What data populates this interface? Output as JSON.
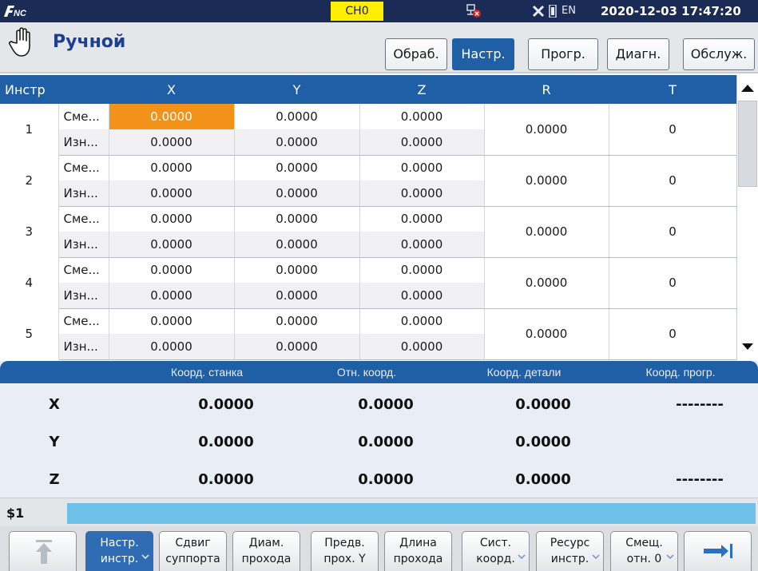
{
  "status_bar": {
    "logo_text": "FNC",
    "channel": "CH0",
    "language": "EN",
    "datetime": "2020-12-03 17:47:20",
    "icons": [
      "network-error-icon",
      "close-icon",
      "bar-icon"
    ]
  },
  "mode": {
    "title": "Ручной",
    "icon": "hand-icon"
  },
  "tabs": [
    {
      "label": "Обраб.",
      "active": false
    },
    {
      "label": "Настр.",
      "active": true
    },
    {
      "label": "Прогр.",
      "active": false
    },
    {
      "label": "Диагн.",
      "active": false
    },
    {
      "label": "Обслуж.",
      "active": false
    }
  ],
  "tool_table": {
    "headers": [
      "Инстр",
      "X",
      "Y",
      "Z",
      "R",
      "T"
    ],
    "selected_cell": {
      "tool": 1,
      "row": "offset",
      "column": "X"
    },
    "tools": [
      {
        "num": "1",
        "offset_label": "Сме...",
        "wear_label": "Изн...",
        "offset": [
          "0.0000",
          "0.0000",
          "0.0000"
        ],
        "wear": [
          "0.0000",
          "0.0000",
          "0.0000"
        ],
        "r": "0.0000",
        "t": "0"
      },
      {
        "num": "2",
        "offset_label": "Сме...",
        "wear_label": "Изн...",
        "offset": [
          "0.0000",
          "0.0000",
          "0.0000"
        ],
        "wear": [
          "0.0000",
          "0.0000",
          "0.0000"
        ],
        "r": "0.0000",
        "t": "0"
      },
      {
        "num": "3",
        "offset_label": "Сме...",
        "wear_label": "Изн...",
        "offset": [
          "0.0000",
          "0.0000",
          "0.0000"
        ],
        "wear": [
          "0.0000",
          "0.0000",
          "0.0000"
        ],
        "r": "0.0000",
        "t": "0"
      },
      {
        "num": "4",
        "offset_label": "Сме...",
        "wear_label": "Изн...",
        "offset": [
          "0.0000",
          "0.0000",
          "0.0000"
        ],
        "wear": [
          "0.0000",
          "0.0000",
          "0.0000"
        ],
        "r": "0.0000",
        "t": "0"
      },
      {
        "num": "5",
        "offset_label": "Сме...",
        "wear_label": "Изн...",
        "offset": [
          "0.0000",
          "0.0000",
          "0.0000"
        ],
        "wear": [
          "0.0000",
          "0.0000",
          "0.0000"
        ],
        "r": "0.0000",
        "t": "0"
      }
    ]
  },
  "coords": {
    "headers": [
      "Коорд. станка",
      "Отн. коорд.",
      "Коорд. детали",
      "Коорд. прогр."
    ],
    "rows": [
      {
        "axis": "X",
        "values": [
          "0.0000",
          "0.0000",
          "0.0000",
          "--------"
        ]
      },
      {
        "axis": "Y",
        "values": [
          "0.0000",
          "0.0000",
          "0.0000",
          ""
        ]
      },
      {
        "axis": "Z",
        "values": [
          "0.0000",
          "0.0000",
          "0.0000",
          "--------"
        ]
      }
    ]
  },
  "command": {
    "prompt": "$1",
    "value": ""
  },
  "softkeys": [
    {
      "icon": "return-to-top-icon"
    },
    {
      "line1": "Настр.",
      "line2": "инстр.",
      "chevron": true,
      "active": true
    },
    {
      "line1": "Сдвиг",
      "line2": "суппорта",
      "chevron": false,
      "active": false
    },
    {
      "line1": "Диам.",
      "line2": "прохода",
      "chevron": false,
      "active": false
    },
    {
      "line1": "Предв.",
      "line2": "прох. Y",
      "chevron": false,
      "active": false
    },
    {
      "line1": "Длина",
      "line2": "прохода",
      "chevron": false,
      "active": false
    },
    {
      "line1": "Сист.",
      "line2": "коорд.",
      "chevron": true,
      "active": false
    },
    {
      "line1": "Ресурс",
      "line2": "инстр.",
      "chevron": true,
      "active": false
    },
    {
      "line1": "Смещ.",
      "line2": "отн. 0",
      "chevron": true,
      "active": false
    },
    {
      "icon": "next-page-icon"
    }
  ],
  "colors": {
    "title_bar": "#1a2b55",
    "header_blue": "#1e5fa6",
    "selection_orange": "#f39219",
    "channel_yellow": "#ffee00",
    "command_input": "#6ec2ea"
  }
}
